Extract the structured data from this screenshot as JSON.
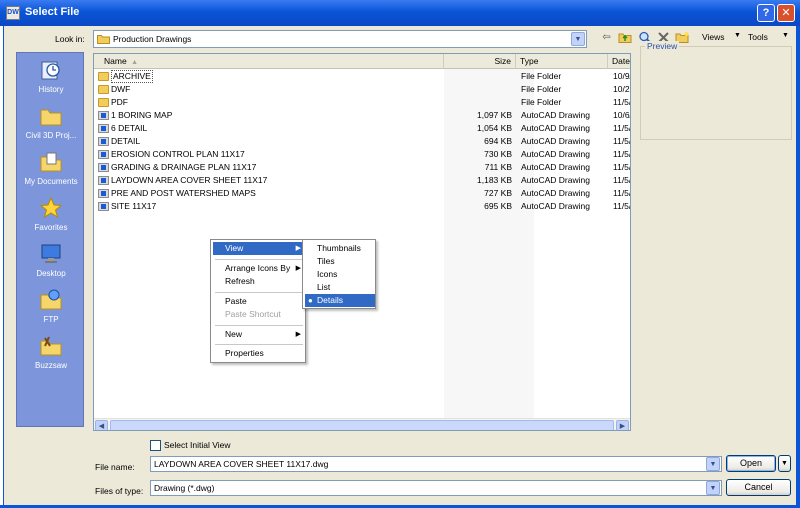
{
  "window": {
    "title": "Select File",
    "app_icon": "dwg-icon",
    "help": "?",
    "close": "✕"
  },
  "lookin": {
    "label": "Look in:",
    "value": "Production Drawings"
  },
  "toolbar": {
    "views": "Views",
    "tools": "Tools"
  },
  "places": [
    {
      "label": "History",
      "icon": "history-icon"
    },
    {
      "label": "Civil 3D Proj...",
      "icon": "folder-icon"
    },
    {
      "label": "My Documents",
      "icon": "my-documents-icon"
    },
    {
      "label": "Favorites",
      "icon": "favorites-star-icon"
    },
    {
      "label": "Desktop",
      "icon": "desktop-icon"
    },
    {
      "label": "FTP",
      "icon": "ftp-icon"
    },
    {
      "label": "Buzzsaw",
      "icon": "buzzsaw-icon"
    }
  ],
  "filelist": {
    "columns": {
      "name": "Name",
      "size": "Size",
      "type": "Type",
      "date": "Date"
    },
    "rows": [
      {
        "name": "ARCHIVE",
        "size": "",
        "type": "File Folder",
        "date": "10/9/",
        "kind": "folder"
      },
      {
        "name": "DWF",
        "size": "",
        "type": "File Folder",
        "date": "10/2:",
        "kind": "folder"
      },
      {
        "name": "PDF",
        "size": "",
        "type": "File Folder",
        "date": "11/5/",
        "kind": "folder"
      },
      {
        "name": "1 BORING MAP",
        "size": "1,097 KB",
        "type": "AutoCAD Drawing",
        "date": "10/6/",
        "kind": "dwg"
      },
      {
        "name": "6 DETAIL",
        "size": "1,054 KB",
        "type": "AutoCAD Drawing",
        "date": "11/5/",
        "kind": "dwg"
      },
      {
        "name": "DETAIL",
        "size": "694 KB",
        "type": "AutoCAD Drawing",
        "date": "11/5/",
        "kind": "dwg"
      },
      {
        "name": "EROSION CONTROL PLAN 11X17",
        "size": "730 KB",
        "type": "AutoCAD Drawing",
        "date": "11/5/",
        "kind": "dwg"
      },
      {
        "name": "GRADING & DRAINAGE PLAN 11X17",
        "size": "711 KB",
        "type": "AutoCAD Drawing",
        "date": "11/5/",
        "kind": "dwg"
      },
      {
        "name": "LAYDOWN AREA COVER SHEET 11X17",
        "size": "1,183 KB",
        "type": "AutoCAD Drawing",
        "date": "11/5/",
        "kind": "dwg"
      },
      {
        "name": "PRE AND POST WATERSHED MAPS",
        "size": "727 KB",
        "type": "AutoCAD Drawing",
        "date": "11/5/",
        "kind": "dwg"
      },
      {
        "name": "SITE 11X17",
        "size": "695 KB",
        "type": "AutoCAD Drawing",
        "date": "11/5/",
        "kind": "dwg"
      }
    ]
  },
  "preview": {
    "label": "Preview"
  },
  "context_menu": {
    "view": "View",
    "arrange": "Arrange Icons By",
    "refresh": "Refresh",
    "paste": "Paste",
    "paste_shortcut": "Paste Shortcut",
    "new": "New",
    "properties": "Properties"
  },
  "view_submenu": {
    "thumbnails": "Thumbnails",
    "tiles": "Tiles",
    "icons": "Icons",
    "list": "List",
    "details": "Details",
    "selected": "Details"
  },
  "select_initial_view": {
    "label": "Select Initial View",
    "checked": false
  },
  "filename": {
    "label": "File name:",
    "value": "LAYDOWN AREA COVER SHEET 11X17.dwg"
  },
  "filetype": {
    "label": "Files of type:",
    "value": "Drawing (*.dwg)"
  },
  "buttons": {
    "open": "Open",
    "cancel": "Cancel"
  }
}
